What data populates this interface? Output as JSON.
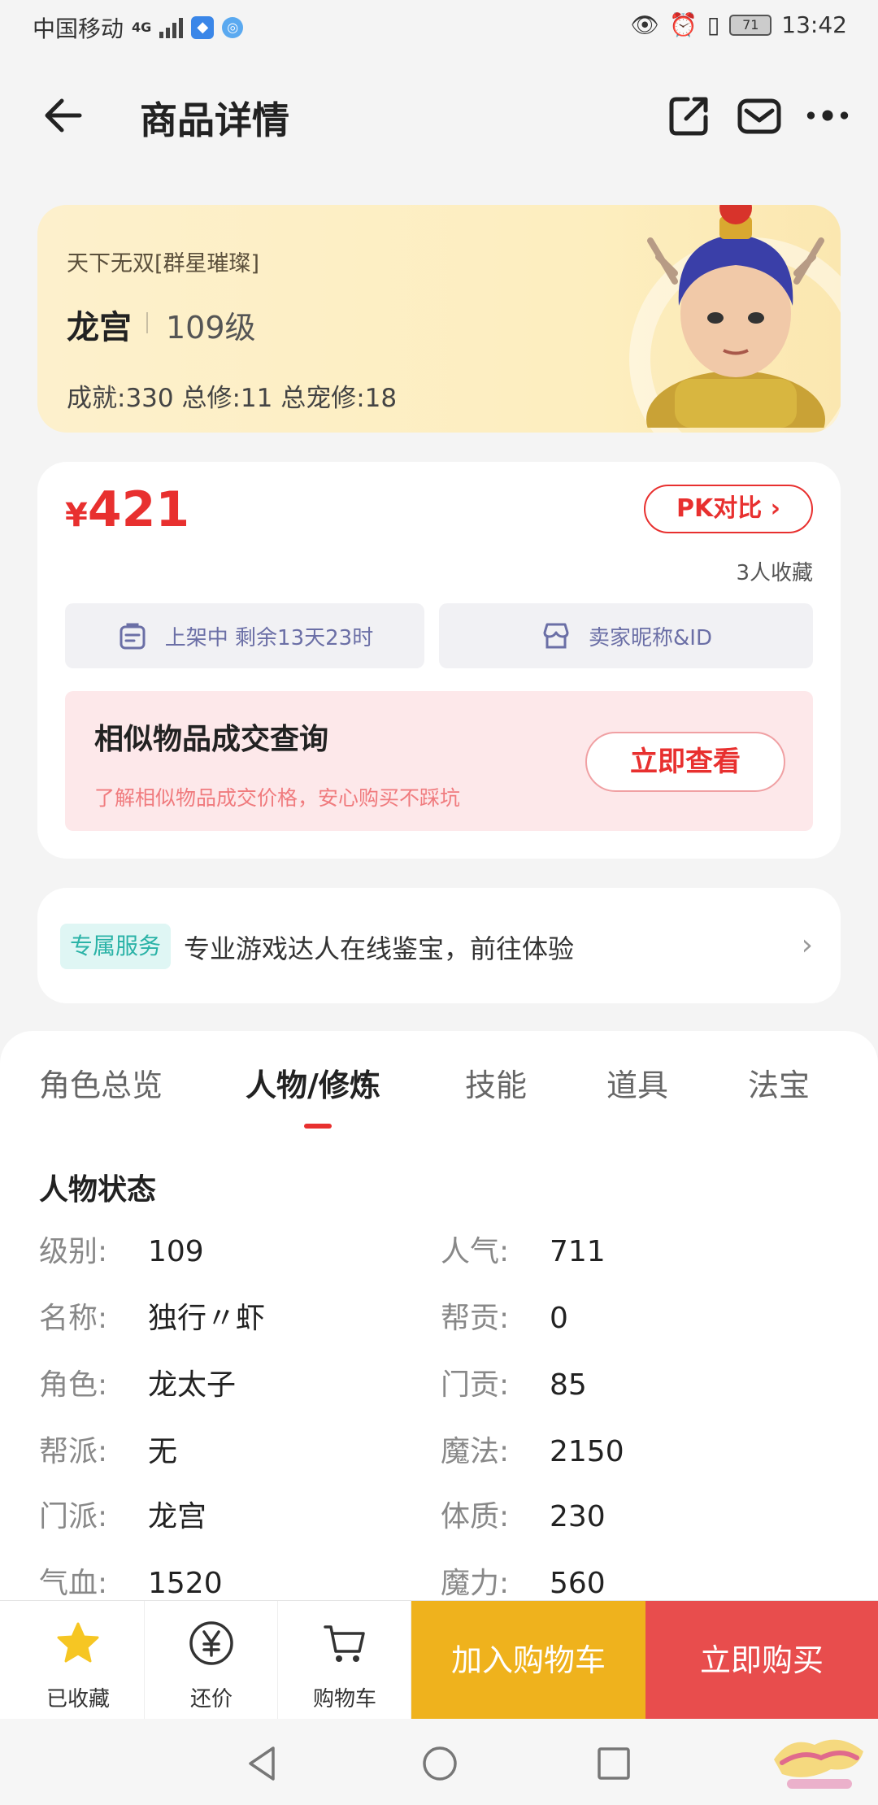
{
  "status_bar": {
    "carrier": "中国移动",
    "network": "4G",
    "battery": "71",
    "time": "13:42"
  },
  "header": {
    "title": "商品详情"
  },
  "hero": {
    "subtitle": "天下无双[群星璀璨]",
    "school": "龙宫",
    "level": "109级",
    "stats": "成就:330 总修:11 总宠修:18"
  },
  "price_card": {
    "currency": "¥",
    "price": "421",
    "pk_label": "PK对比",
    "favorites": "3人收藏",
    "listing_status": "上架中 剩余13天23时",
    "seller": "卖家昵称&ID",
    "similar": {
      "title": "相似物品成交查询",
      "desc": "了解相似物品成交价格，安心购买不踩坑",
      "button": "立即查看"
    }
  },
  "service": {
    "tag": "专属服务",
    "text": "专业游戏达人在线鉴宝，前往体验"
  },
  "tabs": [
    {
      "label": "角色总览"
    },
    {
      "label": "人物/修炼"
    },
    {
      "label": "技能"
    },
    {
      "label": "道具"
    },
    {
      "label": "法宝"
    }
  ],
  "section_title": "人物状态",
  "attributes_left": [
    {
      "label": "级别:",
      "value": "109"
    },
    {
      "label": "名称:",
      "value": "独行〃虾"
    },
    {
      "label": "角色:",
      "value": "龙太子"
    },
    {
      "label": "帮派:",
      "value": "无"
    },
    {
      "label": "门派:",
      "value": "龙宫"
    },
    {
      "label": "气血:",
      "value": "1520"
    }
  ],
  "attributes_right": [
    {
      "label": "人气:",
      "value": "711"
    },
    {
      "label": "帮贡:",
      "value": "0"
    },
    {
      "label": "门贡:",
      "value": "85"
    },
    {
      "label": "魔法:",
      "value": "2150"
    },
    {
      "label": "体质:",
      "value": "230"
    },
    {
      "label": "魔力:",
      "value": "560"
    }
  ],
  "bottom_bar": {
    "favorited": "已收藏",
    "bargain": "还价",
    "cart": "购物车",
    "add_to_cart": "加入购物车",
    "buy_now": "立即购买"
  },
  "colors": {
    "accent_red": "#e8302f",
    "cart_yellow": "#efb21d",
    "buy_red": "#e84d4d",
    "service_teal": "#2bb3a7"
  }
}
